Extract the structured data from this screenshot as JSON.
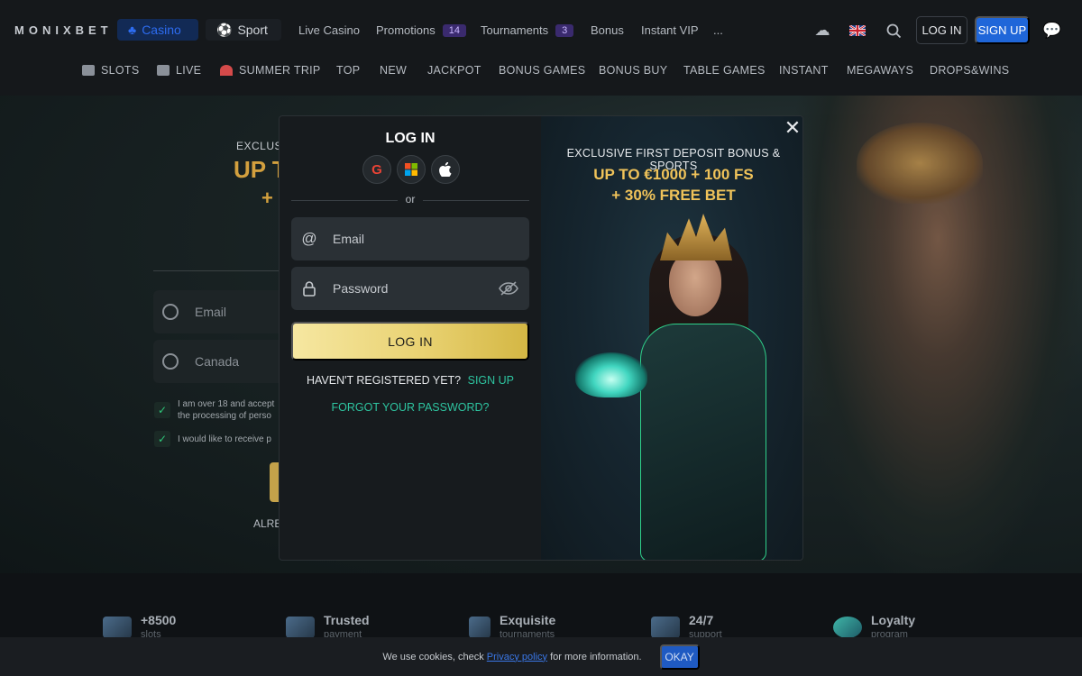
{
  "header": {
    "logo": "MONIXBET",
    "casino_label": "Casino",
    "sport_label": "Sport",
    "links": [
      {
        "label": "Live Casino"
      },
      {
        "label": "Promotions",
        "badge": "14"
      },
      {
        "label": "Tournaments",
        "badge": "3"
      },
      {
        "label": "Bonus"
      },
      {
        "label": "Instant VIP"
      },
      {
        "label": "..."
      }
    ],
    "login_label": "LOG IN",
    "signup_label": "SIGN UP",
    "icons": [
      "download-icon",
      "uk-flag-icon",
      "search-icon",
      "chat-icon"
    ]
  },
  "categories": [
    {
      "label": "SLOTS",
      "icon": "slots-icon"
    },
    {
      "label": "LIVE",
      "icon": "live-icon"
    },
    {
      "label": "SUMMER TRIP",
      "icon": "watermelon-icon"
    },
    {
      "label": "TOP"
    },
    {
      "label": "NEW"
    },
    {
      "label": "JACKPOT"
    },
    {
      "label": "BONUS GAMES"
    },
    {
      "label": "BONUS BUY"
    },
    {
      "label": "TABLE GAMES"
    },
    {
      "label": "INSTANT"
    },
    {
      "label": "MEGAWAYS"
    },
    {
      "label": "DROPS&WINS"
    }
  ],
  "background": {
    "promo_small": "EXCLUS",
    "promo_big": "UP T",
    "promo_plus": "+",
    "email_placeholder": "Email",
    "country_value": "Canada",
    "consent1_line1": "I am over 18 and accept",
    "consent1_line2": "the processing of perso",
    "consent2": "I would like to receive p",
    "already": "ALRE"
  },
  "modal": {
    "title": "LOG IN",
    "or_text": "or",
    "email_placeholder": "Email",
    "password_placeholder": "Password",
    "login_button": "LOG IN",
    "not_registered": "HAVEN'T REGISTERED YET?",
    "signup_link": "SIGN UP",
    "forgot": "FORGOT YOUR PASSWORD?",
    "promo_line1": "EXCLUSIVE FIRST DEPOSIT BONUS & SPORTS",
    "promo_line2": "UP TO €1000 + 100 FS",
    "promo_line3": "+ 30% FREE BET"
  },
  "features": [
    {
      "title": "+8500",
      "subtitle": "slots"
    },
    {
      "title": "Trusted",
      "subtitle": "payment"
    },
    {
      "title": "Exquisite",
      "subtitle": "tournaments"
    },
    {
      "title": "24/7",
      "subtitle": "support"
    },
    {
      "title": "Loyalty",
      "subtitle": "program"
    }
  ],
  "cookie": {
    "text_before": "We use cookies, check",
    "link": "Privacy policy",
    "text_after": "for more information.",
    "button": "OKAY"
  },
  "colors": {
    "accent_blue": "#1f66d9",
    "gold": "#f0c35a",
    "link_green": "#2ec4a0"
  }
}
